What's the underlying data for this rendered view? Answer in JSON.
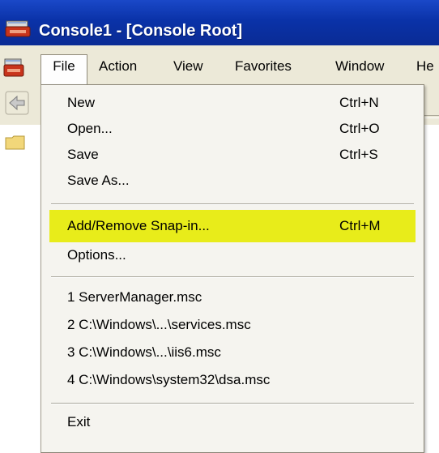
{
  "window": {
    "title": "Console1 - [Console Root]"
  },
  "menubar": {
    "items": [
      {
        "label": "File"
      },
      {
        "label": "Action"
      },
      {
        "label": "View"
      },
      {
        "label": "Favorites"
      },
      {
        "label": "Window"
      },
      {
        "label": "He"
      }
    ]
  },
  "file_menu": {
    "items": [
      {
        "label": "New",
        "shortcut": "Ctrl+N"
      },
      {
        "label": "Open...",
        "shortcut": "Ctrl+O"
      },
      {
        "label": "Save",
        "shortcut": "Ctrl+S"
      },
      {
        "label": "Save As...",
        "shortcut": ""
      },
      {
        "label": "Add/Remove Snap-in...",
        "shortcut": "Ctrl+M",
        "highlighted": true
      },
      {
        "label": "Options...",
        "shortcut": ""
      },
      {
        "label": "1 ServerManager.msc",
        "shortcut": ""
      },
      {
        "label": "2 C:\\Windows\\...\\services.msc",
        "shortcut": ""
      },
      {
        "label": "3 C:\\Windows\\...\\iis6.msc",
        "shortcut": ""
      },
      {
        "label": "4 C:\\Windows\\system32\\dsa.msc",
        "shortcut": ""
      },
      {
        "label": "Exit",
        "shortcut": ""
      }
    ]
  },
  "colors": {
    "titlebar": "#0a32a8",
    "menubar": "#ece9d8",
    "highlight": "#e8ec1a",
    "menu_bg": "#f5f4ef"
  },
  "icons": {
    "title": "mmc-console-icon",
    "menubar": "mmc-console-icon",
    "toolbar_back": "back-arrow-icon",
    "tree": "folder-icon"
  }
}
